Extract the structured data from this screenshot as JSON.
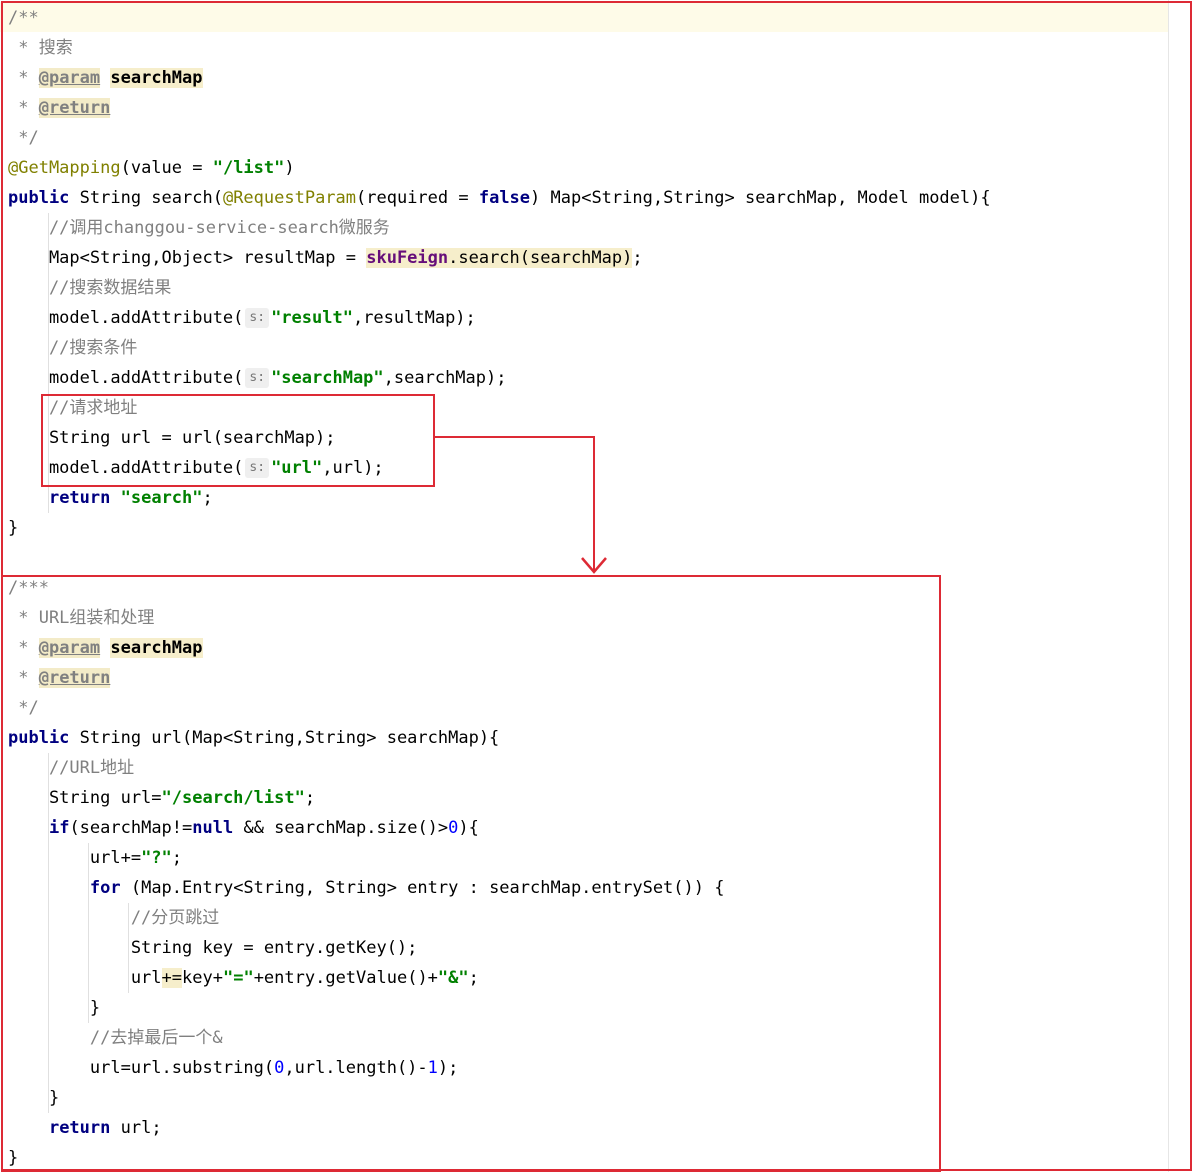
{
  "colors": {
    "comment": "#808080",
    "keyword": "#000080",
    "string": "#008000",
    "annotation": "#808000",
    "number": "#0000ff",
    "field": "#660e7a",
    "annotation_box": "#dd2a35"
  },
  "code": {
    "l01_c": "/**",
    "l02_c": " * 搜索",
    "l03_c": " * ",
    "l03_tag": "@param",
    "l03_s": " ",
    "l03_p": "searchMap",
    "l04_c": " * ",
    "l04_tag": "@return",
    "l05_c": " */",
    "l06_ann": "@GetMapping",
    "l06_t1": "(value = ",
    "l06_str": "\"/list\"",
    "l06_t2": ")",
    "l07_kw": "public",
    "l07_t1": " String search(",
    "l07_ann": "@RequestParam",
    "l07_t2": "(required = ",
    "l07_kw2": "false",
    "l07_t3": ") Map<String,String> searchMap, Model model){",
    "l08_c": "    //调用changgou-service-search微服务",
    "l09_t1": "    Map<String,Object> resultMap = ",
    "l09_f": "skuFeign",
    "l09_t2": ".search(searchMap)",
    "l09_t3": ";",
    "l10_c": "    //搜索数据结果",
    "l11_t1": "    model.addAttribute(",
    "l11_h": "s:",
    "l11_str": "\"result\"",
    "l11_t2": ",resultMap);",
    "l12_c": "    //搜索条件",
    "l13_t1": "    model.addAttribute(",
    "l13_h": "s:",
    "l13_str": "\"searchMap\"",
    "l13_t2": ",searchMap);",
    "l14_c": "    //请求地址",
    "l15_t1": "    String url = url(searchMap);",
    "l16_t1": "    model.addAttribute(",
    "l16_h": "s:",
    "l16_str": "\"url\"",
    "l16_t2": ",url);",
    "l17_t0": "    ",
    "l17_kw": "return",
    "l17_t1": " ",
    "l17_str": "\"search\"",
    "l17_t2": ";",
    "l18_t1": "}",
    "l20_c": "/***",
    "l21_c": " * URL组装和处理",
    "l22_c": " * ",
    "l22_tag": "@param",
    "l22_s": " ",
    "l22_p": "searchMap",
    "l23_c": " * ",
    "l23_tag": "@return",
    "l24_c": " */",
    "l25_kw": "public",
    "l25_t1": " String url(Map<String,String> searchMap){",
    "l26_c": "    //URL地址",
    "l27_t1": "    String url=",
    "l27_str": "\"/search/list\"",
    "l27_t2": ";",
    "l28_t0": "    ",
    "l28_kw": "if",
    "l28_t1": "(searchMap!=",
    "l28_kw2": "null",
    "l28_t2": " && searchMap.size()>",
    "l28_num": "0",
    "l28_t3": "){",
    "l29_t1": "        url+=",
    "l29_str": "\"?\"",
    "l29_t2": ";",
    "l30_t0": "        ",
    "l30_kw": "for",
    "l30_t1": " (Map.Entry<String, String> entry : searchMap.entrySet()) {",
    "l31_c": "            //分页跳过",
    "l32_t1": "            String key = entry.getKey();",
    "l33_t1": "            url",
    "l33_hl": "+=",
    "l33_t2": "key+",
    "l33_str": "\"=\"",
    "l33_t3": "+entry.getValue()+",
    "l33_str2": "\"&\"",
    "l33_t4": ";",
    "l34_t1": "        }",
    "l35_c": "        //去掉最后一个&",
    "l36_t1": "        url=url.substring(",
    "l36_num": "0",
    "l36_t2": ",url.length()-",
    "l36_num2": "1",
    "l36_t3": ");",
    "l37_t1": "    }",
    "l38_t0": "    ",
    "l38_kw": "return",
    "l38_t1": " url;",
    "l39_t1": "}"
  }
}
